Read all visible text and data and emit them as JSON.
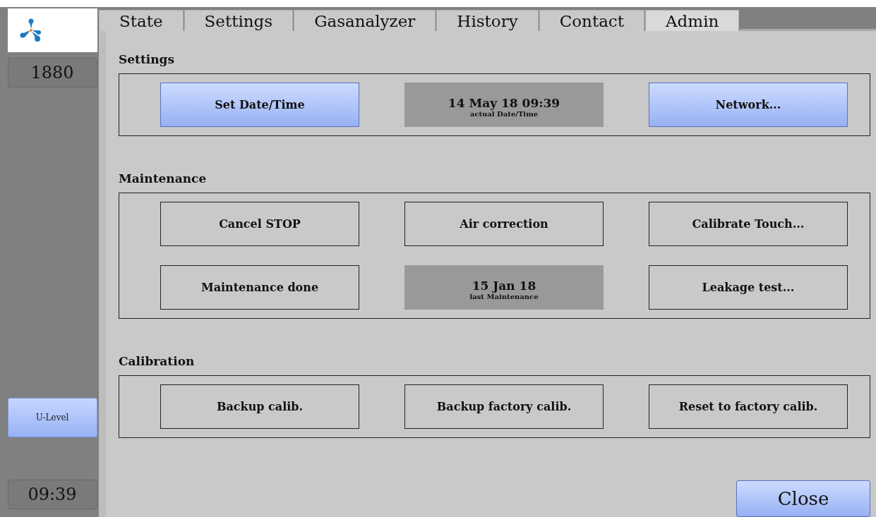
{
  "sidebar": {
    "counter": "1880",
    "u_level_button": "U-Level",
    "clock": "09:39"
  },
  "tabs": [
    {
      "label": "State",
      "selected": false
    },
    {
      "label": "Settings",
      "selected": false
    },
    {
      "label": "Gasanalyzer",
      "selected": false
    },
    {
      "label": "History",
      "selected": false
    },
    {
      "label": "Contact",
      "selected": false
    },
    {
      "label": "Admin",
      "selected": true
    }
  ],
  "sections": [
    {
      "title": "Settings",
      "items": [
        {
          "kind": "primary",
          "label": "Set Date/Time"
        },
        {
          "kind": "info",
          "value": "14 May 18 09:39",
          "caption": "actual Date/Time"
        },
        {
          "kind": "primary",
          "label": "Network..."
        }
      ]
    },
    {
      "title": "Maintenance",
      "items": [
        {
          "kind": "outline",
          "label": "Cancel STOP"
        },
        {
          "kind": "outline",
          "label": "Air correction"
        },
        {
          "kind": "outline",
          "label": "Calibrate Touch..."
        },
        {
          "kind": "outline",
          "label": "Maintenance done"
        },
        {
          "kind": "info",
          "value": "15 Jan 18",
          "caption": "last Maintenance"
        },
        {
          "kind": "outline",
          "label": "Leakage test..."
        }
      ]
    },
    {
      "title": "Calibration",
      "items": [
        {
          "kind": "outline",
          "label": "Backup calib."
        },
        {
          "kind": "outline",
          "label": "Backup factory calib."
        },
        {
          "kind": "outline",
          "label": "Reset to factory calib."
        }
      ]
    }
  ],
  "close_button": "Close"
}
